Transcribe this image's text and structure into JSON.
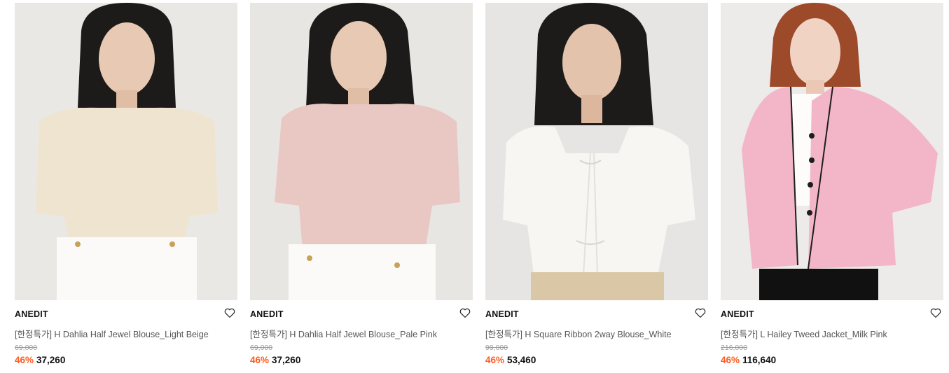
{
  "colors": {
    "discount": "#ff5a1f",
    "text": "#111111",
    "muted": "#9a9a9a",
    "name": "#555555",
    "photo_bg": "#e9e7e4"
  },
  "products": [
    {
      "brand": "ANEDIT",
      "name": "[한정특가] H Dahlia Half Jewel Blouse_Light Beige",
      "original_price": "69,000",
      "discount": "46%",
      "price": "37,260",
      "wishlist_icon": "heart-outline-icon",
      "garment_color": "#efe4cf",
      "hair_color": "#1d1b1a"
    },
    {
      "brand": "ANEDIT",
      "name": "[한정특가] H Dahlia Half Jewel Blouse_Pale Pink",
      "original_price": "69,000",
      "discount": "46%",
      "price": "37,260",
      "wishlist_icon": "heart-outline-icon",
      "garment_color": "#e9c8c4",
      "hair_color": "#1d1b1a"
    },
    {
      "brand": "ANEDIT",
      "name": "[한정특가] H Square Ribbon 2way Blouse_White",
      "original_price": "99,000",
      "discount": "46%",
      "price": "53,460",
      "wishlist_icon": "heart-outline-icon",
      "garment_color": "#f7f6f3",
      "hair_color": "#1d1b1a"
    },
    {
      "brand": "ANEDIT",
      "name": "[한정특가] L Hailey Tweed Jacket_Milk Pink",
      "original_price": "216,000",
      "discount": "46%",
      "price": "116,640",
      "wishlist_icon": "heart-outline-icon",
      "garment_color": "#f2b6c8",
      "hair_color": "#9c4a2a"
    }
  ]
}
